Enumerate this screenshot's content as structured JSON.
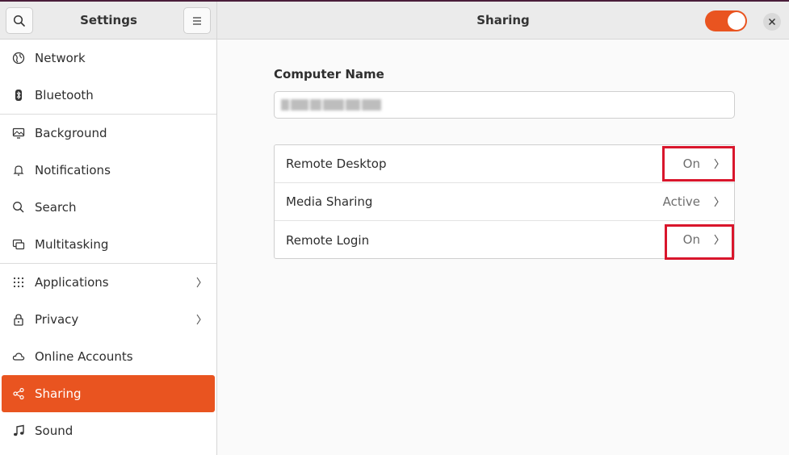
{
  "sidebar": {
    "title": "Settings",
    "items": [
      {
        "label": "Network",
        "icon": "globe-icon"
      },
      {
        "label": "Bluetooth",
        "icon": "bluetooth-icon"
      },
      {
        "label": "Background",
        "icon": "display-icon"
      },
      {
        "label": "Notifications",
        "icon": "bell-icon"
      },
      {
        "label": "Search",
        "icon": "search-icon"
      },
      {
        "label": "Multitasking",
        "icon": "multitasking-icon"
      },
      {
        "label": "Applications",
        "icon": "grid-icon"
      },
      {
        "label": "Privacy",
        "icon": "lock-icon"
      },
      {
        "label": "Online Accounts",
        "icon": "cloud-icon"
      },
      {
        "label": "Sharing",
        "icon": "share-icon",
        "selected": true
      },
      {
        "label": "Sound",
        "icon": "music-note-icon"
      }
    ]
  },
  "header": {
    "title": "Sharing",
    "sharing_enabled": true
  },
  "computer_name": {
    "label": "Computer Name"
  },
  "services": [
    {
      "label": "Remote Desktop",
      "status": "On"
    },
    {
      "label": "Media Sharing",
      "status": "Active"
    },
    {
      "label": "Remote Login",
      "status": "On"
    }
  ],
  "colors": {
    "accent": "#e95420",
    "highlight": "#d9162c"
  }
}
